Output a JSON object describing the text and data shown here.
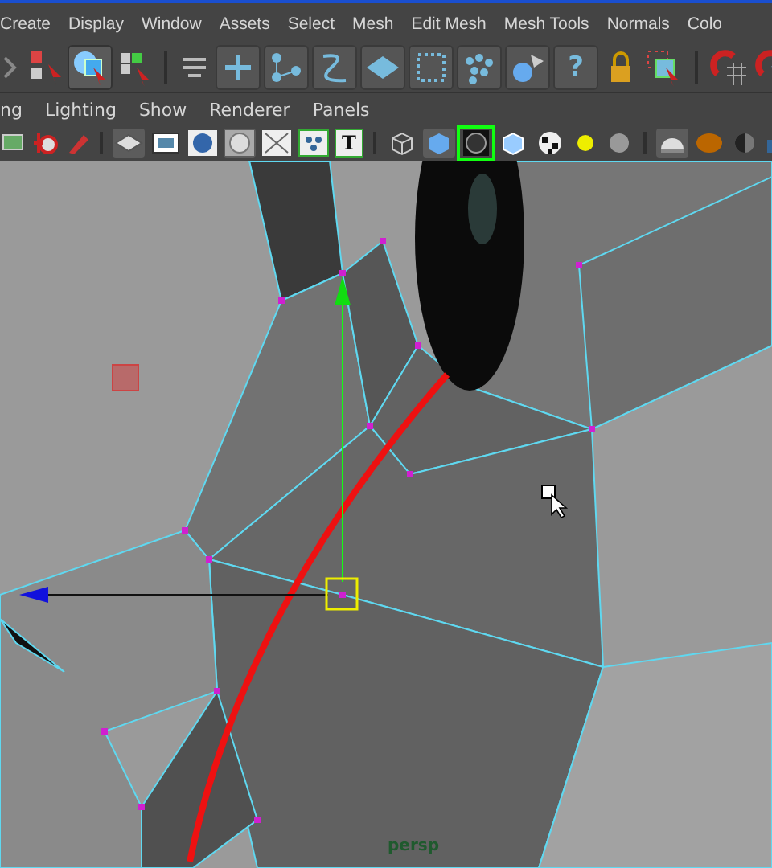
{
  "menu_bar": {
    "items": [
      "Create",
      "Display",
      "Window",
      "Assets",
      "Select",
      "Mesh",
      "Edit Mesh",
      "Mesh Tools",
      "Normals",
      "Colo"
    ]
  },
  "shelf": {
    "help_glyph": "?"
  },
  "panel_menu": {
    "items": [
      "ng",
      "Lighting",
      "Show",
      "Renderer",
      "Panels"
    ]
  },
  "panel_toolbar": {
    "text_glyph": "T",
    "wireframe_on_shaded": true
  },
  "viewport": {
    "camera": "persp"
  }
}
